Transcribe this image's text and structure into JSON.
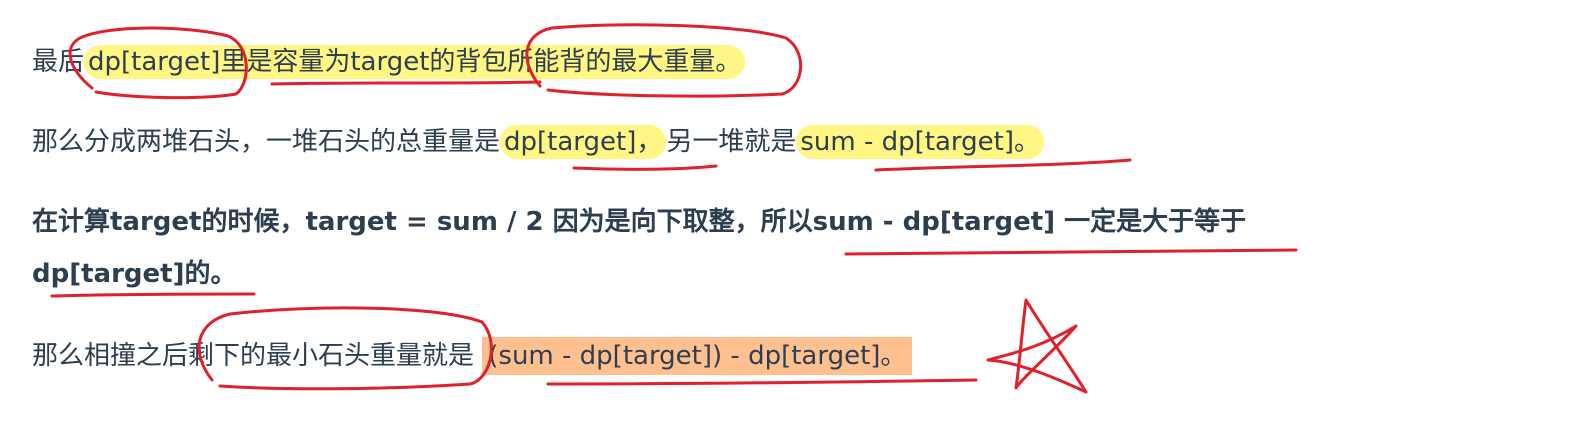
{
  "paragraphs": {
    "p1": {
      "a": "最后",
      "b": "dp[target]里是容量为target的背包所能背的最大重量。"
    },
    "p2": {
      "a": "那么分成两堆石头，一堆石头的总重量是",
      "b": "dp[target]，",
      "c": "另一堆就是",
      "d": "sum - dp[target]。"
    },
    "p3": {
      "line1": "在计算target的时候，target = sum / 2 因为是向下取整，所以sum - dp[target] 一定是大于等于",
      "line2": "dp[target]的。"
    },
    "p4": {
      "a": "那么相撞之后剩下的最小石头重量就是 ",
      "b": "(sum - dp[target]) - dp[target]。"
    }
  },
  "colors": {
    "text": "#2c3e50",
    "highlight_yellow": "#fff56e",
    "highlight_orange": "#ffc08f",
    "ink_red": "#e0202a"
  }
}
